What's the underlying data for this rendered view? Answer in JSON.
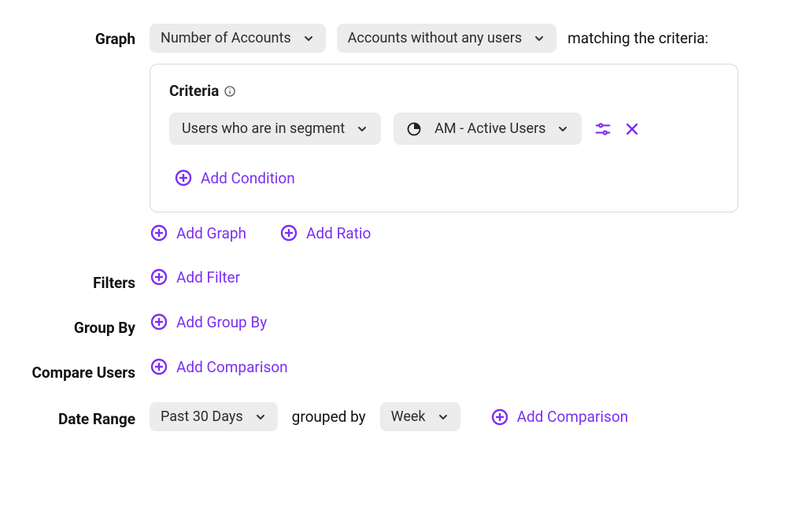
{
  "colors": {
    "accent": "#7b2ff2"
  },
  "graph": {
    "label": "Graph",
    "metric": "Number of Accounts",
    "scope": "Accounts without any users",
    "suffix": "matching the criteria:"
  },
  "criteria": {
    "heading": "Criteria",
    "condition_type": "Users who are in segment",
    "segment_value": "AM - Active Users",
    "add_condition": "Add Condition"
  },
  "graph_actions": {
    "add_graph": "Add Graph",
    "add_ratio": "Add Ratio"
  },
  "filters": {
    "label": "Filters",
    "add_filter": "Add Filter"
  },
  "group_by": {
    "label": "Group By",
    "add_group_by": "Add Group By"
  },
  "compare_users": {
    "label": "Compare Users",
    "add_comparison": "Add Comparison"
  },
  "date_range": {
    "label": "Date Range",
    "range": "Past 30 Days",
    "grouped_by_text": "grouped by",
    "granularity": "Week",
    "add_comparison": "Add Comparison"
  }
}
